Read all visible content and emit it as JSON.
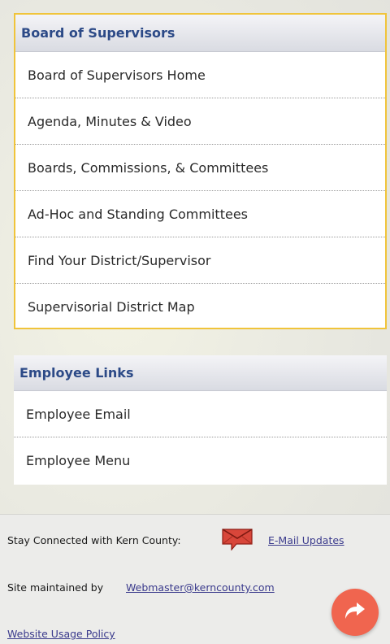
{
  "bos_panel": {
    "title": "Board of Supervisors",
    "items": [
      "Board of Supervisors Home",
      "Agenda, Minutes & Video",
      "Boards, Commissions, & Committees",
      "Ad-Hoc and Standing Committees",
      "Find Your District/Supervisor",
      "Supervisorial District Map"
    ]
  },
  "employee_panel": {
    "title": "Employee Links",
    "items": [
      "Employee Email",
      "Employee Menu"
    ]
  },
  "footer": {
    "stay_connected": "Stay Connected with Kern County:",
    "email_updates": "E-Mail Updates",
    "maintained_by": "Site maintained by",
    "webmaster": "Webmaster@kerncounty.com",
    "usage_policy": "Website Usage Policy"
  },
  "icons": {
    "mail": "envelope-icon",
    "share": "share-arrow-icon"
  },
  "colors": {
    "header_text": "#2c4a87",
    "highlight_border": "#f0c43a",
    "share_button": "#f0654f"
  }
}
